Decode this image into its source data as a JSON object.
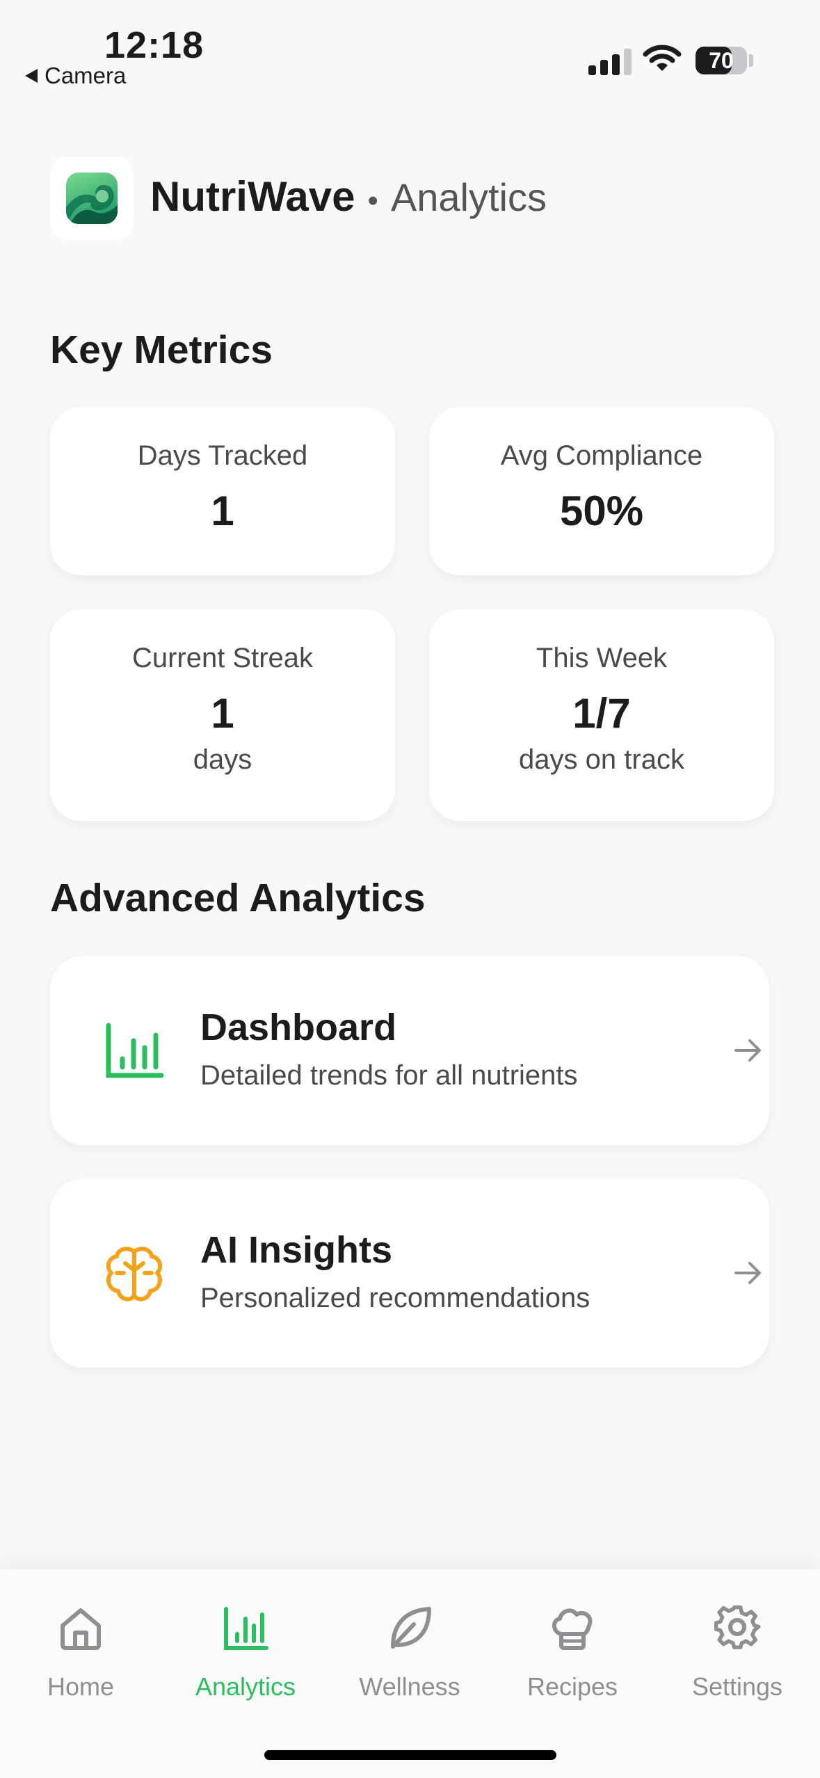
{
  "status_bar": {
    "time": "12:18",
    "back_label": "Camera",
    "battery": "70",
    "battery_level": 0.7
  },
  "header": {
    "app_name": "NutriWave",
    "separator": "•",
    "page": "Analytics"
  },
  "key_metrics": {
    "title": "Key Metrics",
    "cards": [
      {
        "label": "Days Tracked",
        "value": "1",
        "unit": ""
      },
      {
        "label": "Avg Compliance",
        "value": "50%",
        "unit": ""
      },
      {
        "label": "Current Streak",
        "value": "1",
        "unit": "days"
      },
      {
        "label": "This Week",
        "value": "1/7",
        "unit": "days on track"
      }
    ]
  },
  "advanced": {
    "title": "Advanced Analytics",
    "items": [
      {
        "title": "Dashboard",
        "subtitle": "Detailed trends for all nutrients",
        "icon": "bar-chart-icon",
        "color": "#2bbd5e"
      },
      {
        "title": "AI Insights",
        "subtitle": "Personalized recommendations",
        "icon": "brain-icon",
        "color": "#f5a21b"
      }
    ]
  },
  "tabs": [
    {
      "label": "Home",
      "icon": "home-icon",
      "active": false
    },
    {
      "label": "Analytics",
      "icon": "bar-chart-icon",
      "active": true
    },
    {
      "label": "Wellness",
      "icon": "leaf-icon",
      "active": false
    },
    {
      "label": "Recipes",
      "icon": "chef-hat-icon",
      "active": false
    },
    {
      "label": "Settings",
      "icon": "gear-icon",
      "active": false
    }
  ],
  "colors": {
    "accent": "#2bbd5e",
    "insight": "#f5a21b",
    "inactive": "#8e8e93"
  }
}
